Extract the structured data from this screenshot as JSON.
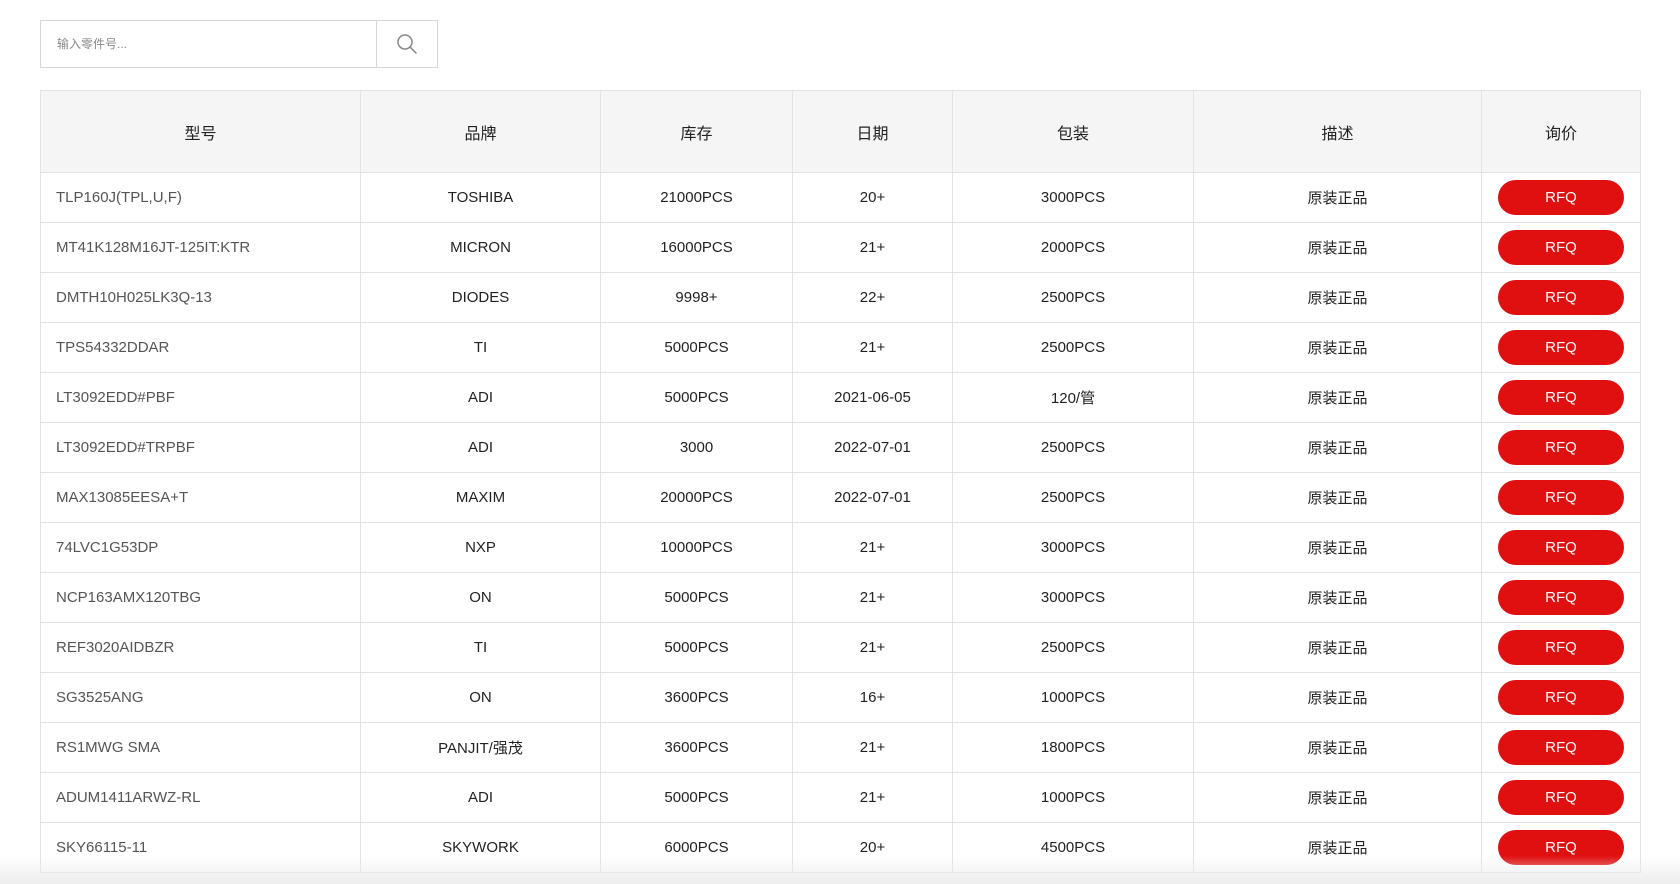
{
  "search": {
    "placeholder": "输入零件号...",
    "icon": "search-icon"
  },
  "table": {
    "headers": [
      "型号",
      "品牌",
      "库存",
      "日期",
      "包装",
      "描述",
      "询价"
    ],
    "rows": [
      {
        "model": "TLP160J(TPL,U,F)",
        "brand": "TOSHIBA",
        "stock": "21000PCS",
        "date": "20+",
        "package": "3000PCS",
        "desc": "原装正品",
        "action": "RFQ"
      },
      {
        "model": "MT41K128M16JT-125IT:KTR",
        "brand": "MICRON",
        "stock": "16000PCS",
        "date": "21+",
        "package": "2000PCS",
        "desc": "原装正品",
        "action": "RFQ"
      },
      {
        "model": "DMTH10H025LK3Q-13",
        "brand": "DIODES",
        "stock": "9998+",
        "date": "22+",
        "package": "2500PCS",
        "desc": "原装正品",
        "action": "RFQ"
      },
      {
        "model": "TPS54332DDAR",
        "brand": "TI",
        "stock": "5000PCS",
        "date": "21+",
        "package": "2500PCS",
        "desc": "原装正品",
        "action": "RFQ"
      },
      {
        "model": "LT3092EDD#PBF",
        "brand": "ADI",
        "stock": "5000PCS",
        "date": "2021-06-05",
        "package": "120/管",
        "desc": "原装正品",
        "action": "RFQ"
      },
      {
        "model": "LT3092EDD#TRPBF",
        "brand": "ADI",
        "stock": "3000",
        "date": "2022-07-01",
        "package": "2500PCS",
        "desc": "原装正品",
        "action": "RFQ"
      },
      {
        "model": "MAX13085EESA+T",
        "brand": "MAXIM",
        "stock": "20000PCS",
        "date": "2022-07-01",
        "package": "2500PCS",
        "desc": "原装正品",
        "action": "RFQ"
      },
      {
        "model": "74LVC1G53DP",
        "brand": "NXP",
        "stock": "10000PCS",
        "date": "21+",
        "package": "3000PCS",
        "desc": "原装正品",
        "action": "RFQ"
      },
      {
        "model": "NCP163AMX120TBG",
        "brand": "ON",
        "stock": "5000PCS",
        "date": "21+",
        "package": "3000PCS",
        "desc": "原装正品",
        "action": "RFQ"
      },
      {
        "model": "REF3020AIDBZR",
        "brand": "TI",
        "stock": "5000PCS",
        "date": "21+",
        "package": "2500PCS",
        "desc": "原装正品",
        "action": "RFQ"
      },
      {
        "model": "SG3525ANG",
        "brand": "ON",
        "stock": "3600PCS",
        "date": "16+",
        "package": "1000PCS",
        "desc": "原装正品",
        "action": "RFQ"
      },
      {
        "model": "RS1MWG SMA",
        "brand": "PANJIT/强茂",
        "stock": "3600PCS",
        "date": "21+",
        "package": "1800PCS",
        "desc": "原装正品",
        "action": "RFQ"
      },
      {
        "model": "ADUM1411ARWZ-RL",
        "brand": "ADI",
        "stock": "5000PCS",
        "date": "21+",
        "package": "1000PCS",
        "desc": "原装正品",
        "action": "RFQ"
      },
      {
        "model": "SKY66115-11",
        "brand": "SKYWORK",
        "stock": "6000PCS",
        "date": "20+",
        "package": "4500PCS",
        "desc": "原装正品",
        "action": "RFQ"
      }
    ]
  },
  "colors": {
    "accent": "#e01010",
    "header_bg": "#f5f5f5",
    "border": "#e3e3e3"
  }
}
